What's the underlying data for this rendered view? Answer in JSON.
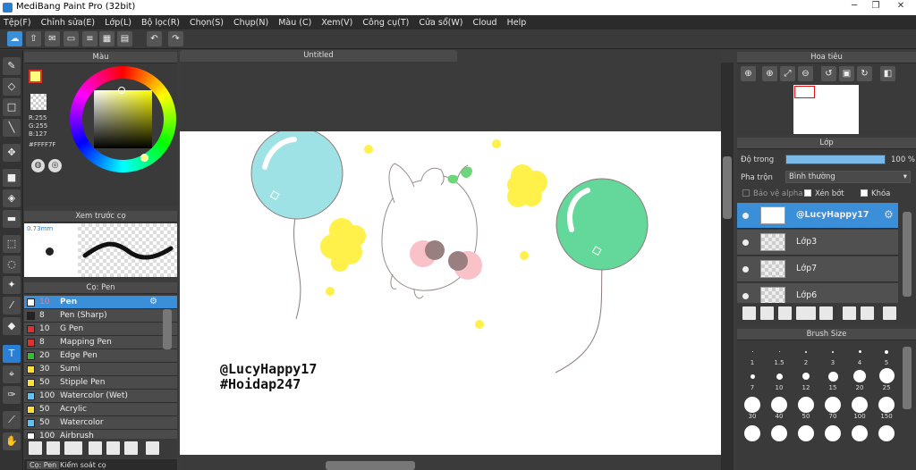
{
  "window": {
    "title": "MediBang Paint Pro (32bit)"
  },
  "menu": [
    "Tệp(F)",
    "Chỉnh sửa(E)",
    "Lớp(L)",
    "Bộ lọc(R)",
    "Chọn(S)",
    "Chụp(N)",
    "Màu (C)",
    "Xem(V)",
    "Công cụ(T)",
    "Cửa sổ(W)",
    "Cloud",
    "Help"
  ],
  "colorPanel": {
    "title": "Màu",
    "r": "R:255",
    "g": "G:255",
    "b": "B:127",
    "hex": "#FFFF7F",
    "fg": "#ffff7f"
  },
  "brushPreview": {
    "title": "Xem trước cọ",
    "size": "0.73mm"
  },
  "brushPanel": {
    "title": "Cọ: Pen",
    "items": [
      {
        "size": "10",
        "name": "Pen",
        "color": "#ffffff"
      },
      {
        "size": "8",
        "name": "Pen (Sharp)",
        "color": "#222222"
      },
      {
        "size": "10",
        "name": "G Pen",
        "color": "#e03030"
      },
      {
        "size": "8",
        "name": "Mapping Pen",
        "color": "#e03030"
      },
      {
        "size": "20",
        "name": "Edge Pen",
        "color": "#30c030"
      },
      {
        "size": "30",
        "name": "Sumi",
        "color": "#ffe030"
      },
      {
        "size": "50",
        "name": "Stipple Pen",
        "color": "#ffe030"
      },
      {
        "size": "100",
        "name": "Watercolor (Wet)",
        "color": "#60c0f0"
      },
      {
        "size": "50",
        "name": "Acrylic",
        "color": "#ffe030"
      },
      {
        "size": "50",
        "name": "Watercolor",
        "color": "#60c0f0"
      },
      {
        "size": "100",
        "name": "Airbrush",
        "color": "#ffffff"
      }
    ]
  },
  "bottomTabs": [
    "Cọ: Pen",
    "Kiểm soát cọ"
  ],
  "canvas": {
    "tab": "Untitled",
    "text1": "@LucyHappy17",
    "text2": "#Hoidap247"
  },
  "navigator": {
    "title": "Hoa tiêu"
  },
  "layerPanel": {
    "title": "Lớp",
    "opacityLabel": "Độ trong",
    "opacityValue": "100 %",
    "opacity": 1.0,
    "blendLabel": "Pha trộn",
    "blendValue": "Bình thường",
    "protectAlpha": "Bảo vệ alpha",
    "clipping": "Xén bớt",
    "lock": "Khóa",
    "layers": [
      "@LucyHappy17",
      "Lớp3",
      "Lớp7",
      "Lớp6"
    ]
  },
  "brushSize": {
    "title": "Brush Size",
    "sizes": [
      "1",
      "1.5",
      "2",
      "3",
      "4",
      "5",
      "7",
      "10",
      "12",
      "15",
      "20",
      "25",
      "30",
      "40",
      "50",
      "70",
      "100",
      "150"
    ]
  }
}
